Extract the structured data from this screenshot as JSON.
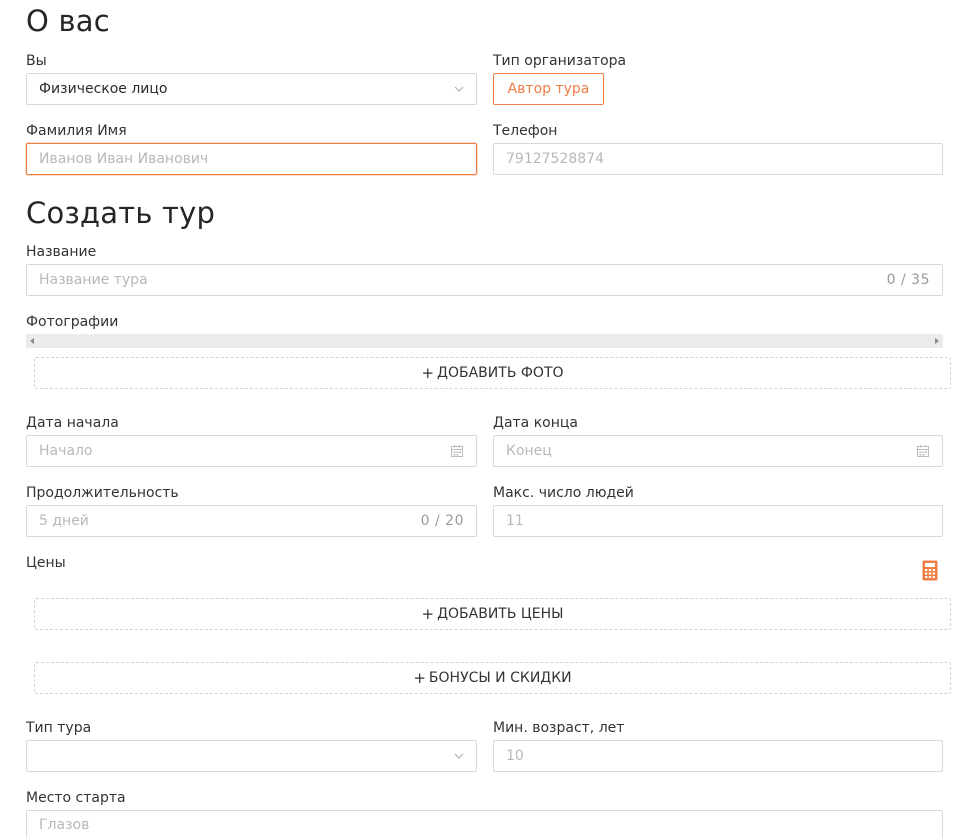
{
  "about": {
    "title": "О вас",
    "you_label": "Вы",
    "you_value": "Физическое лицо",
    "organizer_type_label": "Тип организатора",
    "organizer_type_button": "Автор тура",
    "fullname_label": "Фамилия Имя",
    "fullname_placeholder": "Иванов Иван Иванович",
    "phone_label": "Телефон",
    "phone_placeholder": "79127528874"
  },
  "create": {
    "title": "Создать тур",
    "name_label": "Название",
    "name_placeholder": "Название тура",
    "name_counter": "0 / 35",
    "photos_label": "Фотографии",
    "add_photo": "ДОБАВИТЬ ФОТО",
    "start_date_label": "Дата начала",
    "start_date_placeholder": "Начало",
    "end_date_label": "Дата конца",
    "end_date_placeholder": "Конец",
    "duration_label": "Продолжительность",
    "duration_placeholder": "5 дней",
    "duration_counter": "0 / 20",
    "max_people_label": "Макс. число людей",
    "max_people_placeholder": "11",
    "prices_label": "Цены",
    "add_prices": "ДОБАВИТЬ ЦЕНЫ",
    "bonuses": "БОНУСЫ И СКИДКИ",
    "tour_type_label": "Тип тура",
    "tour_type_value": "",
    "min_age_label": "Мин. возраст, лет",
    "min_age_placeholder": "10",
    "start_place_label": "Место старта",
    "start_place_placeholder": "Глазов",
    "plus_sign": "+"
  },
  "icons": {
    "calendar": "calendar-icon",
    "calculator": "calculator-icon",
    "chevron": "chevron-down-icon"
  },
  "colors": {
    "accent": "#f07c45",
    "border": "#d9d9d9",
    "placeholder": "#b8b8b8"
  }
}
